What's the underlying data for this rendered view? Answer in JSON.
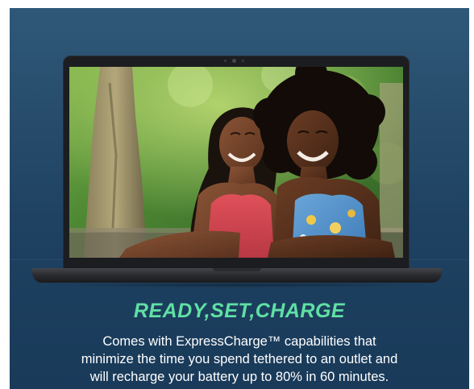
{
  "headline": "READY,SET,CHARGE",
  "body_lines": [
    "Comes with ExpressCharge™ capabilities that",
    "minimize the time you spend tethered to an outlet and",
    "will recharge your battery up to 80% in 60 minutes."
  ],
  "colors": {
    "background": "#274c6b",
    "headline": "#5fe0a4",
    "body_text": "#ffffff",
    "laptop_bezel": "#1c1d20"
  }
}
